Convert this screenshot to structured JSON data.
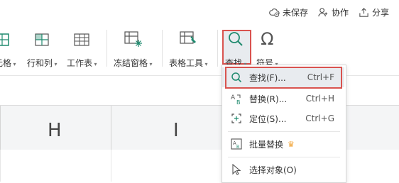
{
  "topbar": {
    "unsaved": "未保存",
    "collab": "协作",
    "share": "分享"
  },
  "ribbon": {
    "items": [
      {
        "label": "元格"
      },
      {
        "label": "行和列"
      },
      {
        "label": "工作表"
      },
      {
        "label": "冻结窗格"
      },
      {
        "label": "表格工具"
      },
      {
        "label": "查找"
      },
      {
        "label": "符号"
      }
    ]
  },
  "columns": [
    "H",
    "I"
  ],
  "menu": {
    "items": [
      {
        "label": "查找(F)...",
        "shortcut": "Ctrl+F"
      },
      {
        "label": "替换(R)...",
        "shortcut": "Ctrl+H"
      },
      {
        "label": "定位(S)...",
        "shortcut": "Ctrl+G"
      },
      {
        "label": "批量替换",
        "shortcut": ""
      },
      {
        "label": "选择对象(O)",
        "shortcut": ""
      }
    ]
  },
  "colors": {
    "accent": "#1f8a6e",
    "highlight": "#d9534f",
    "crown": "#f0a030"
  }
}
